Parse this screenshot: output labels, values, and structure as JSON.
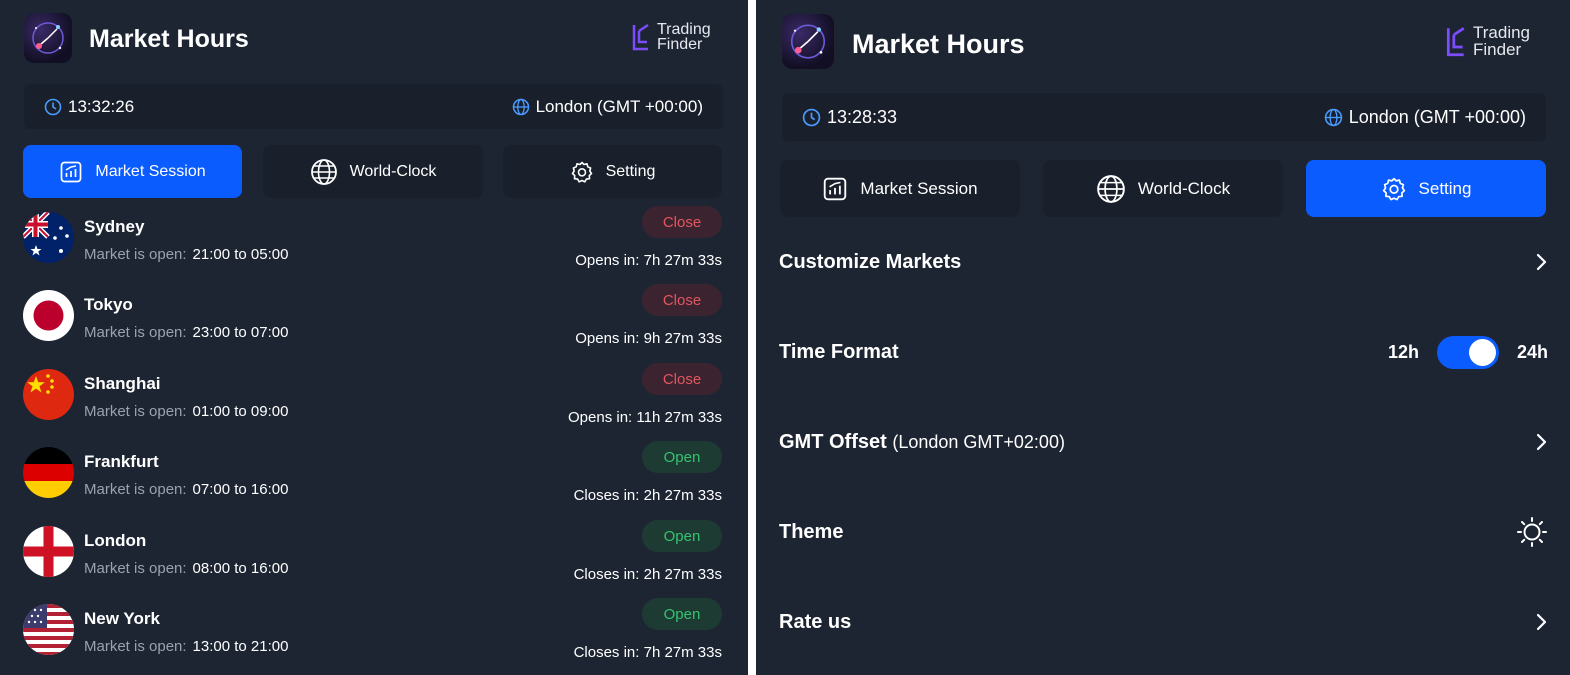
{
  "left_panel": {
    "title": "Market Hours",
    "brand": {
      "line1": "Trading",
      "line2": "Finder"
    },
    "time": "13:32:26",
    "timezone": "London (GMT +00:00)",
    "tabs": [
      {
        "label": "Market Session",
        "active": true
      },
      {
        "label": "World-Clock",
        "active": false
      },
      {
        "label": "Setting",
        "active": false
      }
    ],
    "hours_label": "Market is open:",
    "markets": [
      {
        "name": "Sydney",
        "hours": "21:00 to 05:00",
        "status": "Close",
        "countdown": "Opens in: 7h 27m 33s",
        "flag": "australia"
      },
      {
        "name": "Tokyo",
        "hours": "23:00 to 07:00",
        "status": "Close",
        "countdown": "Opens in: 9h 27m 33s",
        "flag": "japan"
      },
      {
        "name": "Shanghai",
        "hours": "01:00 to 09:00",
        "status": "Close",
        "countdown": "Opens in: 11h 27m 33s",
        "flag": "china"
      },
      {
        "name": "Frankfurt",
        "hours": "07:00 to 16:00",
        "status": "Open",
        "countdown": "Closes in: 2h 27m 33s",
        "flag": "germany"
      },
      {
        "name": "London",
        "hours": "08:00 to 16:00",
        "status": "Open",
        "countdown": "Closes in: 2h 27m 33s",
        "flag": "england"
      },
      {
        "name": "New York",
        "hours": "13:00 to 21:00",
        "status": "Open",
        "countdown": "Closes in: 7h 27m 33s",
        "flag": "usa"
      }
    ]
  },
  "right_panel": {
    "title": "Market Hours",
    "brand": {
      "line1": "Trading",
      "line2": "Finder"
    },
    "time": "13:28:33",
    "timezone": "London (GMT +00:00)",
    "tabs": [
      {
        "label": "Market Session",
        "active": false
      },
      {
        "label": "World-Clock",
        "active": false
      },
      {
        "label": "Setting",
        "active": true
      }
    ],
    "settings": {
      "customize_markets": "Customize Markets",
      "time_format": "Time Format",
      "time_format_left": "12h",
      "time_format_right": "24h",
      "time_format_selected": "24h",
      "gmt_offset": "GMT Offset",
      "gmt_offset_value": "(London GMT+02:00)",
      "theme": "Theme",
      "rate_us": "Rate us"
    }
  },
  "colors": {
    "background": "#1d2533",
    "surface": "#19202c",
    "accent": "#0a5cff",
    "close_text": "#e2565f",
    "open_text": "#33c46f",
    "muted_text": "#9aa2b1"
  },
  "icons": {
    "clock": "clock-icon",
    "globe": "globe-icon",
    "chart": "chart-icon",
    "gear": "gear-icon",
    "chevron": "chevron-right-icon",
    "sun": "sun-icon"
  }
}
